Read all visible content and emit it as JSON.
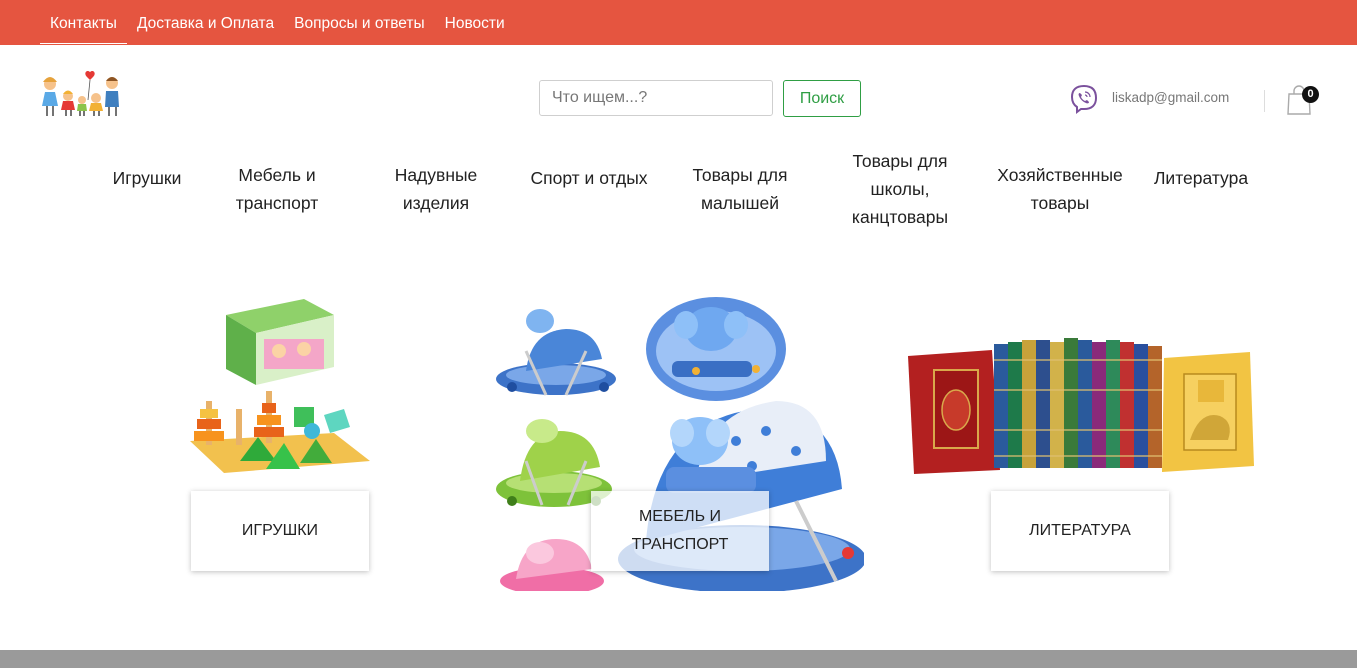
{
  "topnav": {
    "items": [
      {
        "label": "Контакты",
        "active": true
      },
      {
        "label": "Доставка и Оплата",
        "active": false
      },
      {
        "label": "Вопросы и ответы",
        "active": false
      },
      {
        "label": "Новости",
        "active": false
      }
    ]
  },
  "header": {
    "search_placeholder": "Что ищем...?",
    "search_button": "Поиск",
    "email": "liskadp@gmail.com",
    "cart_count": "0"
  },
  "categories": [
    "Игрушки",
    "Мебель и\nтранспорт",
    "Надувные\nизделия",
    "Спорт и отдых",
    "Товары для\nмалышей",
    "Товары для\nшколы,\nканцтовары",
    "Хозяйственные\nтовары",
    "Литература"
  ],
  "tiles": [
    {
      "label": "Игрушки",
      "image": "toys-image"
    },
    {
      "label": "Мебель и транспорт",
      "image": "baby-walkers-image"
    },
    {
      "label": "Литература",
      "image": "books-image"
    }
  ],
  "colors": {
    "topbar": "#e55540",
    "search_button": "#2f9e44",
    "viber": "#7b519d",
    "footer": "#9a9a9a"
  },
  "icons": [
    "family-logo-icon",
    "viber-icon",
    "shopping-bag-icon"
  ]
}
